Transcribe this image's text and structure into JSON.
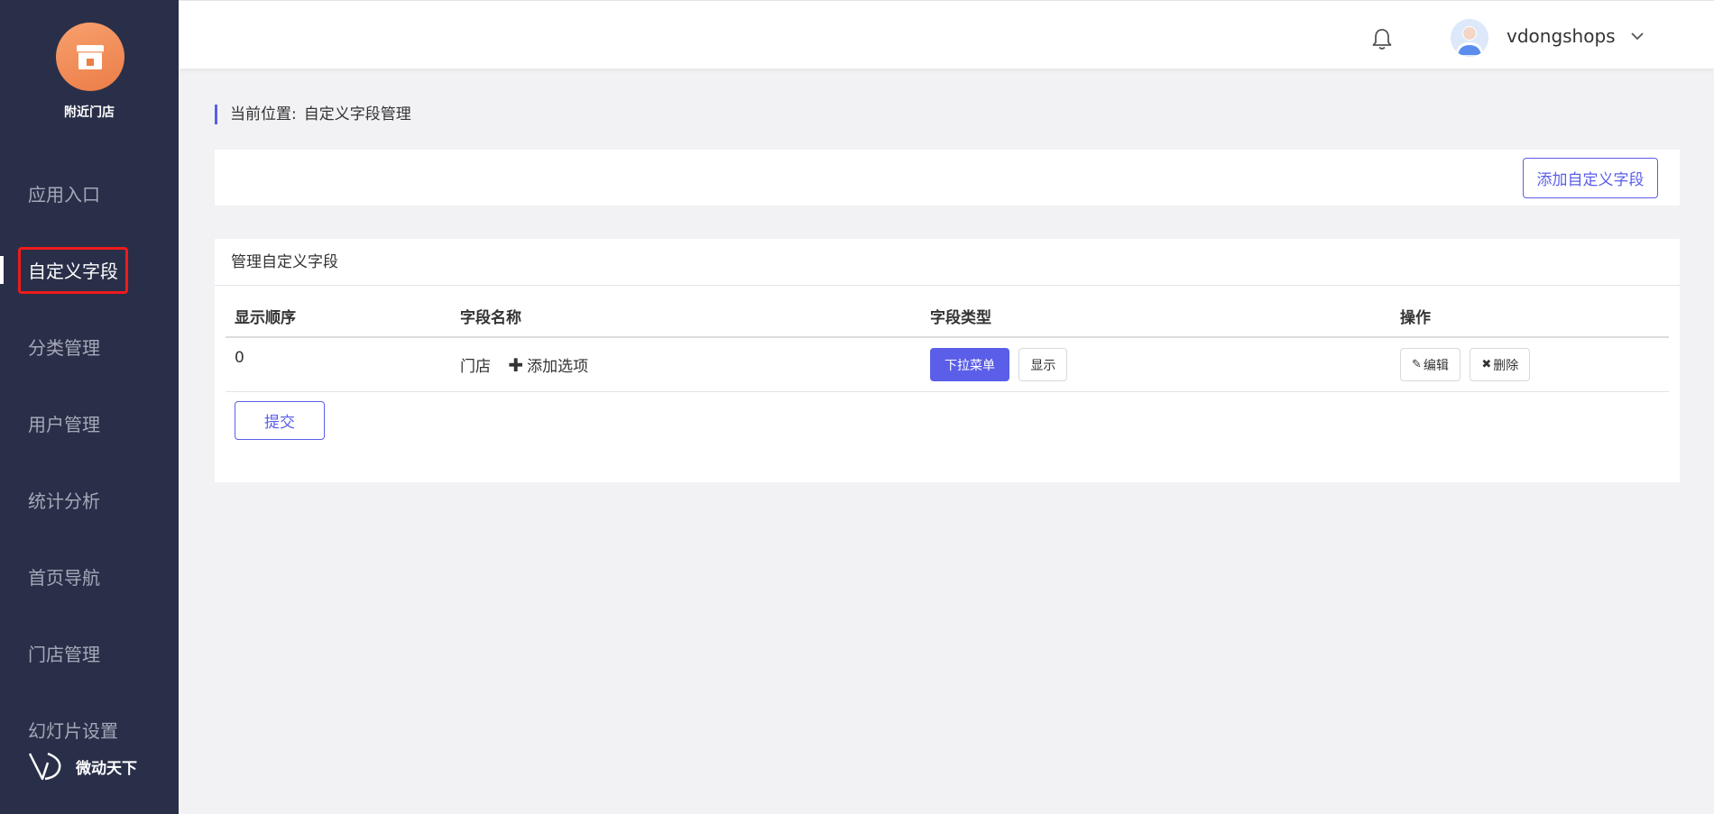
{
  "sidebar": {
    "logo_name": "附近门店",
    "items": [
      {
        "label": "应用入口"
      },
      {
        "label": "自定义字段"
      },
      {
        "label": "分类管理"
      },
      {
        "label": "用户管理"
      },
      {
        "label": "统计分析"
      },
      {
        "label": "首页导航"
      },
      {
        "label": "门店管理"
      },
      {
        "label": "幻灯片设置"
      }
    ],
    "active_index": 1,
    "brand": "微动天下"
  },
  "header": {
    "username": "vdongshops"
  },
  "breadcrumb": {
    "prefix": "当前位置:",
    "current": "自定义字段管理"
  },
  "toolbar": {
    "add_label": "添加自定义字段"
  },
  "panel": {
    "title": "管理自定义字段",
    "columns": [
      "显示顺序",
      "字段名称",
      "字段类型",
      "操作"
    ],
    "rows": [
      {
        "order": "0",
        "name": "门店",
        "add_option": "添加选项",
        "type": "下拉菜单",
        "visibility": "显示",
        "edit": "编辑",
        "delete": "删除"
      }
    ],
    "submit_label": "提交"
  },
  "colors": {
    "sidebar_bg": "#2a2f49",
    "accent": "#5b5ee8",
    "logo_orange": "#ec7d47",
    "highlight_red": "#ef1b1b"
  }
}
